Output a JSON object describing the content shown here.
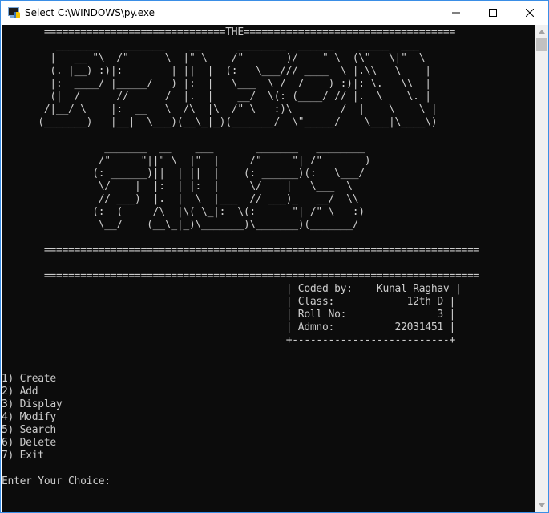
{
  "window": {
    "title": "Select C:\\WINDOWS\\py.exe"
  },
  "console": {
    "banner_title_line": "       ==============================THE===================================",
    "logo_prison": [
      "         _______    _______    __      ________  ______    _____  ___  ",
      "        |   __ \"\\  /\"      \\  |\" \\    /\"       )/    \" \\  (\\\"   \\|\"  \\ ",
      "        (. |__) :)|:        | ||  |  (:   \\___/// ____  \\ |.\\\\   \\    |",
      "        |:  ____/ |_____/   ) |:  |   \\___  \\ /  /    ) :)|: \\.   \\\\  |",
      "        (|  /      //      /  |.  |    __/  \\(: (____/ // |.  \\    \\. |",
      "       /|__/ \\    |:  __   \\  /\\  |\\  /\" \\   :)\\        /  |    \\    \\ |",
      "      (_______)   |__|  \\___)(__\\_|_)(_______/  \\\"_____/    \\___|\\____\\)"
    ],
    "logo_files": [
      "                 _______  __    ___       _______   ________  ",
      "                /\"     \"||\" \\  |\"  |     /\"     \"| /\"       ) ",
      "               (: ______)||  | ||  |    (: ______)(:   \\___/  ",
      "                \\/    |  |:  | |:  |     \\/    |   \\___  \\    ",
      "                // ___)  |.  |  \\  |___  // ___)_   __/  \\\\   ",
      "               (:  (     /\\  |\\( \\_|:  \\(:      \"| /\" \\   :)  ",
      "                \\__/    (__\\_|_)\\_______)\\_______)(_______/   "
    ],
    "divider_a": "       ========================================================================",
    "divider_b": "       ========================================================================",
    "credits": [
      "                                               | Coded by:    Kunal Raghav |",
      "                                               | Class:            12th D |",
      "                                               | Roll No:               3 |",
      "                                               | Admno:          22031451 |",
      "                                               +--------------------------+"
    ],
    "menu": [
      "1) Create",
      "2) Add",
      "3) Display",
      "4) Modify",
      "5) Search",
      "6) Delete",
      "7) Exit"
    ],
    "prompt": "Enter Your Choice: "
  },
  "icons": {
    "app": "python-console-icon",
    "minimize": "minimize-icon",
    "maximize": "maximize-icon",
    "close": "close-icon"
  }
}
